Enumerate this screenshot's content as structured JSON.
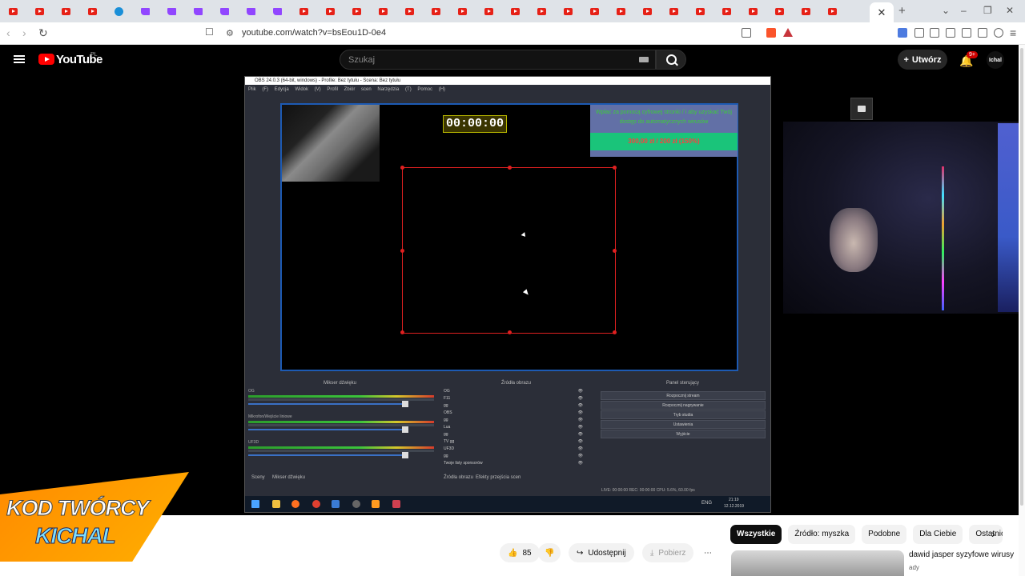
{
  "browser": {
    "url": "youtube.com/watch?v=bsEou1D-0e4",
    "tab_close": "✕",
    "new_tab": "+",
    "favicons": [
      "yt",
      "yt",
      "yt",
      "yt",
      "edge",
      "tw",
      "tw",
      "tw",
      "tw",
      "tw",
      "tw",
      "yt",
      "yt",
      "yt",
      "yt",
      "yt",
      "yt",
      "yt",
      "yt",
      "yt",
      "yt",
      "yt",
      "yt",
      "yt",
      "yt",
      "yt",
      "yt",
      "yt",
      "yt",
      "yt",
      "yt",
      "yt"
    ]
  },
  "youtube": {
    "wordmark": "YouTube",
    "country": "PL",
    "search_placeholder": "Szukaj",
    "create_label": "Utwórz",
    "notif_badge": "9+",
    "avatar_text": "Ichal"
  },
  "obs": {
    "title": "OBS 24.0.3 (64-bit, windows) - Profile: Bez tytułu - Scena: Bez tytułu",
    "menu": "Plik (F)   Edycja   Widok (V)   Profil   Zbiór scen   Narzędzia (T)   Pomoc (H)",
    "timer": "00:00:00",
    "donation_header": "Wpłać za pomocą cyfrowej stronki / i aby uzyskać Twój dostęp do automatycznych wirusów",
    "goal": "300,00 zł / 200 zł (150%)",
    "docks": {
      "mixer": "Mikser dźwięku",
      "sources": "Źródła obrazu",
      "controls": "Panel sterujący"
    },
    "mixer_tracks": [
      "OG",
      "Mikrofon/Wejście liniowe",
      "UF3D"
    ],
    "sources": [
      "OG",
      "F11",
      "gg",
      "OBS",
      "gg",
      "Lua",
      "gg",
      "TV gg",
      "UF3D",
      "gg",
      "Twoje listy sponsorów"
    ],
    "controls": [
      "Rozpocznij stream",
      "Rozpocznij nagrywanie",
      "Tryb studia",
      "Ustawienia",
      "Wyjście"
    ],
    "scene_tabs": [
      "Sceny",
      "Mikser dźwięku"
    ],
    "source_tabs": [
      "Źródła obrazu",
      "Efekty przejścia scen"
    ],
    "status": "LIVE: 00:00:00    REC: 00:00:00    CPU: 5.6%, 60.00 fps",
    "clock_time": "21:19",
    "clock_date": "12.12.2019",
    "lang": "ENG"
  },
  "promo": {
    "line1": "KOD TWÓRCY",
    "line2": "KICHAL"
  },
  "actions": {
    "likes": "85",
    "share": "Udostępnij",
    "download": "Pobierz",
    "more": "⋯"
  },
  "chips": [
    "Wszystkie",
    "Źródło: myszka",
    "Podobne",
    "Dla Ciebie",
    "Ostatnio"
  ],
  "recommendation": {
    "title": "dawid jasper syzyfowe wirusy",
    "channel": "ady"
  }
}
